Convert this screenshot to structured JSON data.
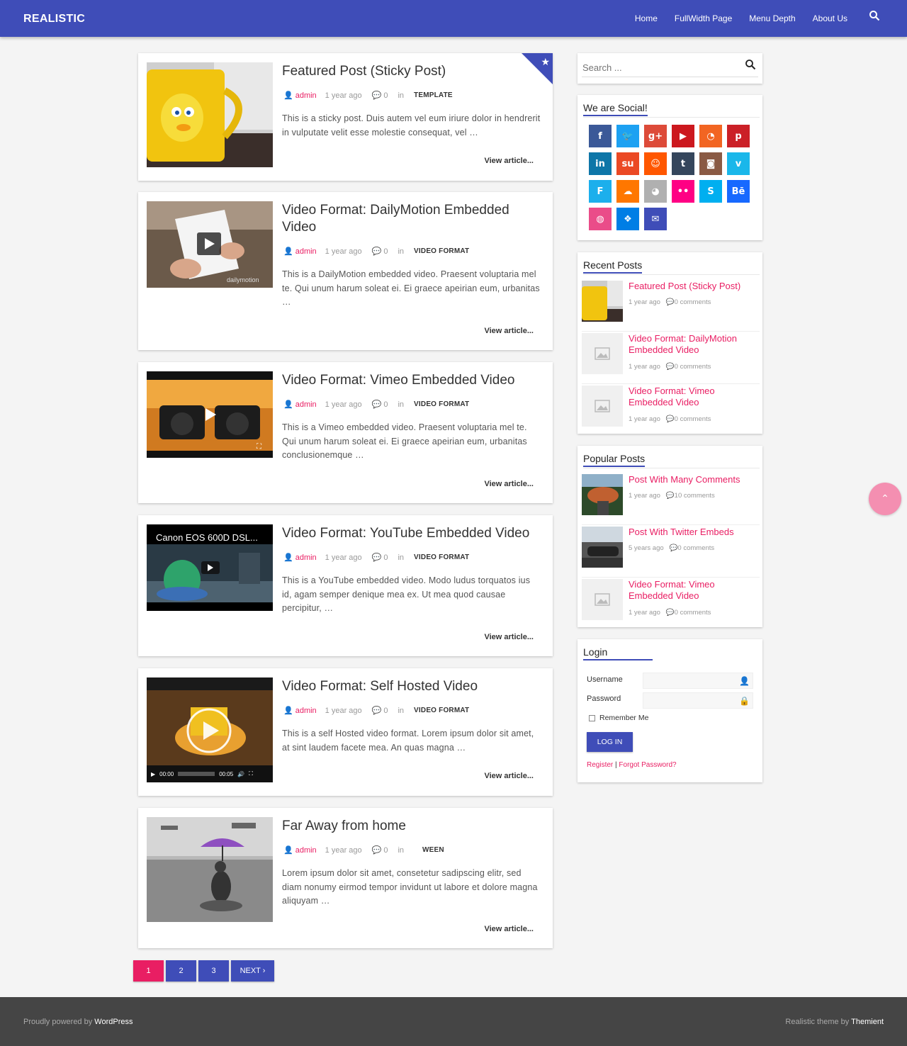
{
  "header": {
    "brand": "REALISTIC",
    "nav": [
      "Home",
      "FullWidth Page",
      "Menu Depth",
      "About Us"
    ]
  },
  "posts": [
    {
      "title": "Featured Post (Sticky Post)",
      "author": "admin",
      "date": "1 year ago",
      "comments": "0",
      "in": "in",
      "category": "TEMPLATE",
      "excerpt": "This is a sticky post. Duis autem vel eum iriure dolor in hendrerit in vulputate velit esse molestie consequat, vel …",
      "readmore": "View article..."
    },
    {
      "title": "Video Format: DailyMotion Embedded Video",
      "author": "admin",
      "date": "1 year ago",
      "comments": "0",
      "in": "in",
      "category": "VIDEO FORMAT",
      "excerpt": "This is a DailyMotion embedded video. Praesent voluptaria mel te. Qui unum harum soleat ei. Ei graece apeirian eum, urbanitas …",
      "readmore": "View article...",
      "thumb_label": "dailymotion"
    },
    {
      "title": "Video Format: Vimeo Embedded Video",
      "author": "admin",
      "date": "1 year ago",
      "comments": "0",
      "in": "in",
      "category": "VIDEO FORMAT",
      "excerpt": "This is a Vimeo embedded video. Praesent voluptaria mel te. Qui unum harum soleat ei. Ei graece apeirian eum, urbanitas conclusionemque …",
      "readmore": "View article..."
    },
    {
      "title": "Video Format: YouTube Embedded Video",
      "author": "admin",
      "date": "1 year ago",
      "comments": "0",
      "in": "in",
      "category": "VIDEO FORMAT",
      "excerpt": "This is a YouTube embedded video. Modo ludus torquatos ius id, agam semper denique mea ex. Ut mea quod causae percipitur, …",
      "readmore": "View article...",
      "thumb_label": "Canon EOS 600D DSL..."
    },
    {
      "title": "Video Format: Self Hosted Video",
      "author": "admin",
      "date": "1 year ago",
      "comments": "0",
      "in": "in",
      "category": "VIDEO FORMAT",
      "excerpt": "This is a self Hosted video format.  Lorem ipsum dolor sit amet, at sint laudem facete mea. An quas magna …",
      "readmore": "View article...",
      "time_current": "00:00",
      "time_total": "00:05"
    },
    {
      "title": "Far Away from home",
      "author": "admin",
      "date": "1 year ago",
      "comments": "0",
      "in": "in",
      "category": "WEEN",
      "excerpt": "Lorem ipsum dolor sit amet, consetetur sadipscing elitr, sed diam nonumy eirmod tempor invidunt ut labore et dolore magna aliquyam …",
      "readmore": "View article..."
    }
  ],
  "pagination": {
    "pages": [
      "1",
      "2",
      "3"
    ],
    "next": "NEXT ›",
    "current": "1"
  },
  "sidebar": {
    "search_placeholder": "Search ...",
    "social": {
      "title": "We are Social!",
      "icons": [
        {
          "name": "facebook-icon",
          "glyph": "f",
          "color": "#3b5998"
        },
        {
          "name": "twitter-icon",
          "glyph": "🐦",
          "color": "#1da1f2"
        },
        {
          "name": "google-plus-icon",
          "glyph": "g+",
          "color": "#dd4b39"
        },
        {
          "name": "youtube-icon",
          "glyph": "▶",
          "color": "#cc181e"
        },
        {
          "name": "rss-icon",
          "glyph": "◔",
          "color": "#f26522"
        },
        {
          "name": "pinterest-icon",
          "glyph": "p",
          "color": "#cb2027"
        },
        {
          "name": "linkedin-icon",
          "glyph": "in",
          "color": "#0e76a8"
        },
        {
          "name": "stumbleupon-icon",
          "glyph": "su",
          "color": "#eb4924"
        },
        {
          "name": "reddit-icon",
          "glyph": "☺",
          "color": "#ff5700"
        },
        {
          "name": "tumblr-icon",
          "glyph": "t",
          "color": "#35465c"
        },
        {
          "name": "instagram-icon",
          "glyph": "◙",
          "color": "#8a5a44"
        },
        {
          "name": "vimeo-icon",
          "glyph": "v",
          "color": "#1ab7ea"
        },
        {
          "name": "foursquare-icon",
          "glyph": "F",
          "color": "#1cafec"
        },
        {
          "name": "soundcloud-icon",
          "glyph": "☁",
          "color": "#ff7700"
        },
        {
          "name": "github-icon",
          "glyph": "◕",
          "color": "#b0b0b0"
        },
        {
          "name": "flickr-icon",
          "glyph": "••",
          "color": "#ff0084"
        },
        {
          "name": "skype-icon",
          "glyph": "S",
          "color": "#00aff0"
        },
        {
          "name": "behance-icon",
          "glyph": "Bē",
          "color": "#1769ff"
        },
        {
          "name": "dribbble-icon",
          "glyph": "◍",
          "color": "#ea4c89"
        },
        {
          "name": "dropbox-icon",
          "glyph": "❖",
          "color": "#007ee5"
        },
        {
          "name": "email-icon",
          "glyph": "✉",
          "color": "#3f4db8"
        }
      ]
    },
    "recent": {
      "title": "Recent Posts",
      "items": [
        {
          "title": "Featured Post (Sticky Post)",
          "date": "1 year ago",
          "comments": "0 comments"
        },
        {
          "title": "Video Format: DailyMotion Embedded Video",
          "date": "1 year ago",
          "comments": "0 comments"
        },
        {
          "title": "Video Format: Vimeo Embedded Video",
          "date": "1 year ago",
          "comments": "0 comments"
        }
      ]
    },
    "popular": {
      "title": "Popular Posts",
      "items": [
        {
          "title": "Post With Many Comments",
          "date": "1 year ago",
          "comments": "10 comments"
        },
        {
          "title": "Post With Twitter Embeds",
          "date": "5 years ago",
          "comments": "0 comments"
        },
        {
          "title": "Video Format: Vimeo Embedded Video",
          "date": "1 year ago",
          "comments": "0 comments"
        }
      ]
    },
    "login": {
      "title": "Login",
      "username_label": "Username",
      "password_label": "Password",
      "remember": "Remember Me",
      "button": "LOG IN",
      "register": "Register",
      "separator": "|",
      "forgot": "Forgot Password?"
    }
  },
  "footer": {
    "left_prefix": "Proudly powered by",
    "left_link": "WordPress",
    "right_prefix": "Realistic theme by",
    "right_link": "Themient"
  },
  "colors": {
    "primary": "#3f4db8",
    "accent": "#e91e63",
    "footer": "#454545"
  }
}
